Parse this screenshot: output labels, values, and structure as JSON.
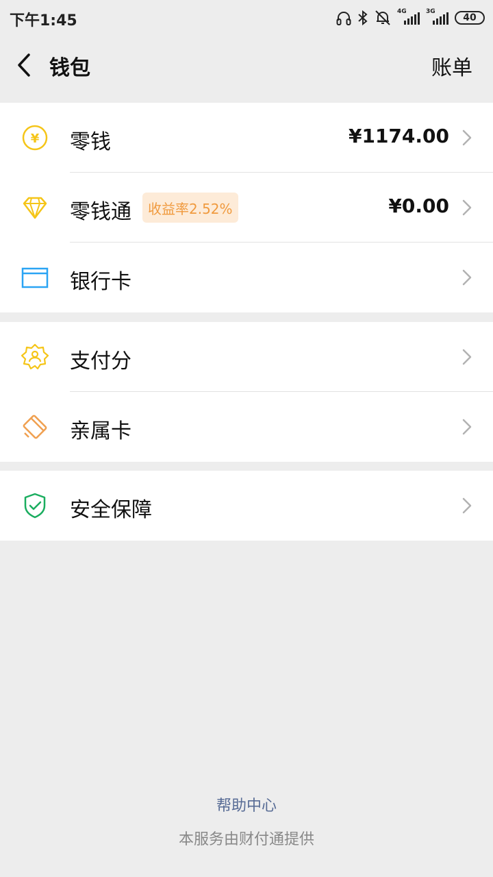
{
  "status_bar": {
    "time": "下午1:45",
    "network1": "4G",
    "network2": "3G",
    "battery": "40"
  },
  "nav": {
    "title": "钱包",
    "action": "账单"
  },
  "groups": [
    {
      "items": [
        {
          "label": "零钱",
          "value": "¥1174.00",
          "icon": "yuan-coin-icon"
        },
        {
          "label": "零钱通",
          "badge": "收益率2.52%",
          "value": "¥0.00",
          "icon": "diamond-icon"
        },
        {
          "label": "银行卡",
          "icon": "bank-card-icon"
        }
      ]
    },
    {
      "items": [
        {
          "label": "支付分",
          "icon": "credit-score-icon"
        },
        {
          "label": "亲属卡",
          "icon": "family-card-icon"
        }
      ]
    },
    {
      "items": [
        {
          "label": "安全保障",
          "icon": "security-shield-icon"
        }
      ]
    }
  ],
  "footer": {
    "help_link": "帮助中心",
    "provider_note": "本服务由财付通提供"
  },
  "colors": {
    "background": "#ededed",
    "yellow_icon": "#f5c518",
    "blue_icon": "#2aa4f4",
    "orange_icon": "#f0a050",
    "green_icon": "#1aad5f",
    "link": "#576b95"
  }
}
